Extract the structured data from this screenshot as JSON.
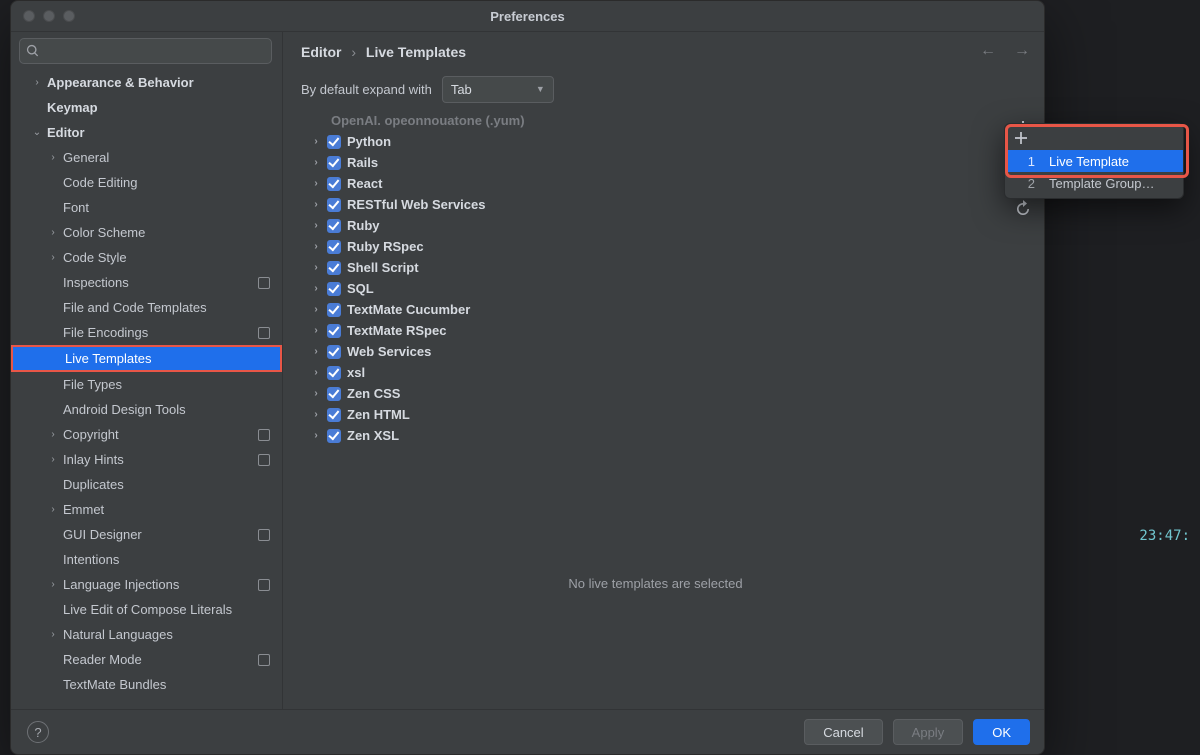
{
  "window": {
    "title": "Preferences"
  },
  "bg_clock": "23:47:",
  "search": {
    "placeholder": ""
  },
  "sidebar": {
    "items": [
      {
        "label": "Appearance & Behavior",
        "indent": 0,
        "chev": "›",
        "bold": true
      },
      {
        "label": "Keymap",
        "indent": 0,
        "chev": "",
        "bold": true
      },
      {
        "label": "Editor",
        "indent": 0,
        "chev": "⌄",
        "bold": true
      },
      {
        "label": "General",
        "indent": 1,
        "chev": "›"
      },
      {
        "label": "Code Editing",
        "indent": 1,
        "chev": ""
      },
      {
        "label": "Font",
        "indent": 1,
        "chev": ""
      },
      {
        "label": "Color Scheme",
        "indent": 1,
        "chev": "›"
      },
      {
        "label": "Code Style",
        "indent": 1,
        "chev": "›"
      },
      {
        "label": "Inspections",
        "indent": 1,
        "chev": "",
        "badge": true
      },
      {
        "label": "File and Code Templates",
        "indent": 1,
        "chev": ""
      },
      {
        "label": "File Encodings",
        "indent": 1,
        "chev": "",
        "badge": true
      },
      {
        "label": "Live Templates",
        "indent": 1,
        "chev": "",
        "selected": true
      },
      {
        "label": "File Types",
        "indent": 1,
        "chev": ""
      },
      {
        "label": "Android Design Tools",
        "indent": 1,
        "chev": ""
      },
      {
        "label": "Copyright",
        "indent": 1,
        "chev": "›",
        "badge": true
      },
      {
        "label": "Inlay Hints",
        "indent": 1,
        "chev": "›",
        "badge": true
      },
      {
        "label": "Duplicates",
        "indent": 1,
        "chev": ""
      },
      {
        "label": "Emmet",
        "indent": 1,
        "chev": "›"
      },
      {
        "label": "GUI Designer",
        "indent": 1,
        "chev": "",
        "badge": true
      },
      {
        "label": "Intentions",
        "indent": 1,
        "chev": ""
      },
      {
        "label": "Language Injections",
        "indent": 1,
        "chev": "›",
        "badge": true
      },
      {
        "label": "Live Edit of Compose Literals",
        "indent": 1,
        "chev": ""
      },
      {
        "label": "Natural Languages",
        "indent": 1,
        "chev": "›"
      },
      {
        "label": "Reader Mode",
        "indent": 1,
        "chev": "",
        "badge": true
      },
      {
        "label": "TextMate Bundles",
        "indent": 1,
        "chev": ""
      }
    ]
  },
  "breadcrumb": {
    "a": "Editor",
    "b": "Live Templates"
  },
  "expand": {
    "label": "By default expand with",
    "value": "Tab"
  },
  "template_header_truncated": "OpenAI. opeonnouatone (.yum)",
  "templates": [
    "Python",
    "Rails",
    "React",
    "RESTful Web Services",
    "Ruby",
    "Ruby RSpec",
    "Shell Script",
    "SQL",
    "TextMate Cucumber",
    "TextMate RSpec",
    "Web Services",
    "xsl",
    "Zen CSS",
    "Zen HTML",
    "Zen XSL"
  ],
  "empty_message": "No live templates are selected",
  "popup": {
    "items": [
      {
        "num": "1",
        "label": "Live Template",
        "selected": true
      },
      {
        "num": "2",
        "label": "Template Group…"
      }
    ]
  },
  "footer": {
    "cancel": "Cancel",
    "apply": "Apply",
    "ok": "OK"
  }
}
